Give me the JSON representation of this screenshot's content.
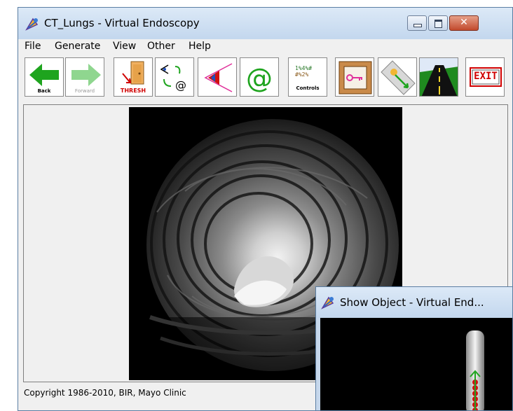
{
  "main_window": {
    "title": "CT_Lungs - Virtual Endoscopy",
    "controls": {
      "minimize": "minimize",
      "maximize": "maximize",
      "close": "✕"
    }
  },
  "menu": [
    "File",
    "Generate",
    "View",
    "Other",
    "Help"
  ],
  "toolbar": {
    "back_label": "Back",
    "forward_label": "Forward",
    "thresh_label": "THRESH",
    "controls_label": "Controls",
    "exit_label": "EXIT",
    "buttons": [
      "back-arrow",
      "forward-arrow",
      "thresh-door",
      "view-at-swap",
      "view-eye",
      "at-sign",
      "controls",
      "key-frame",
      "path-navigate",
      "road",
      "exit-sign"
    ]
  },
  "statusbar": {
    "text": "Copyright 1986-2010, BIR, Mayo Clinic"
  },
  "child_window": {
    "title": "Show Object - Virtual End..."
  },
  "colors": {
    "titlebar": "#c3d7ee",
    "back_arrow": "#1ea41e",
    "forward_arrow": "#8fd68f",
    "thresh_red": "#d00000",
    "close_button": "#c24a2d"
  }
}
